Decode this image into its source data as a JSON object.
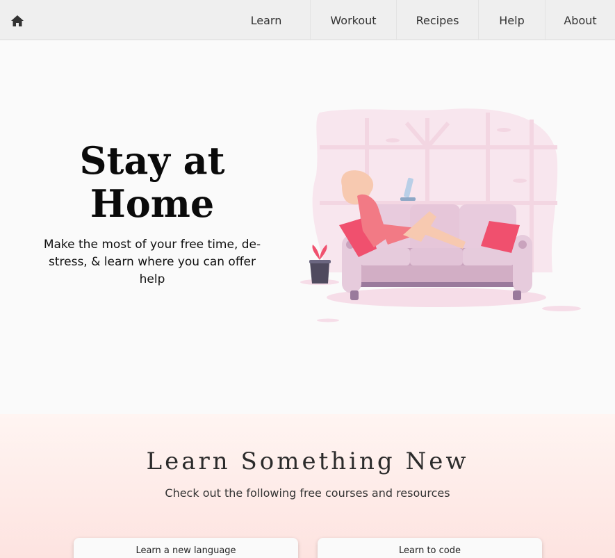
{
  "navbar": {
    "home_icon": "home-icon",
    "links": [
      "Learn",
      "Workout",
      "Recipes",
      "Help",
      "About"
    ]
  },
  "hero": {
    "title_line1": "Stay at",
    "title_line2": "Home",
    "subtitle": "Make the most of your free time, de-stress, & learn where you can offer help"
  },
  "learn_section": {
    "title": "Learn Something New",
    "subtitle": "Check out the following free courses and resources",
    "cards": [
      "Learn a new language",
      "Learn to code"
    ]
  },
  "colors": {
    "nav_bg": "#efefef",
    "accent_pink": "#f0506e",
    "sofa": "#e6cbdc"
  }
}
